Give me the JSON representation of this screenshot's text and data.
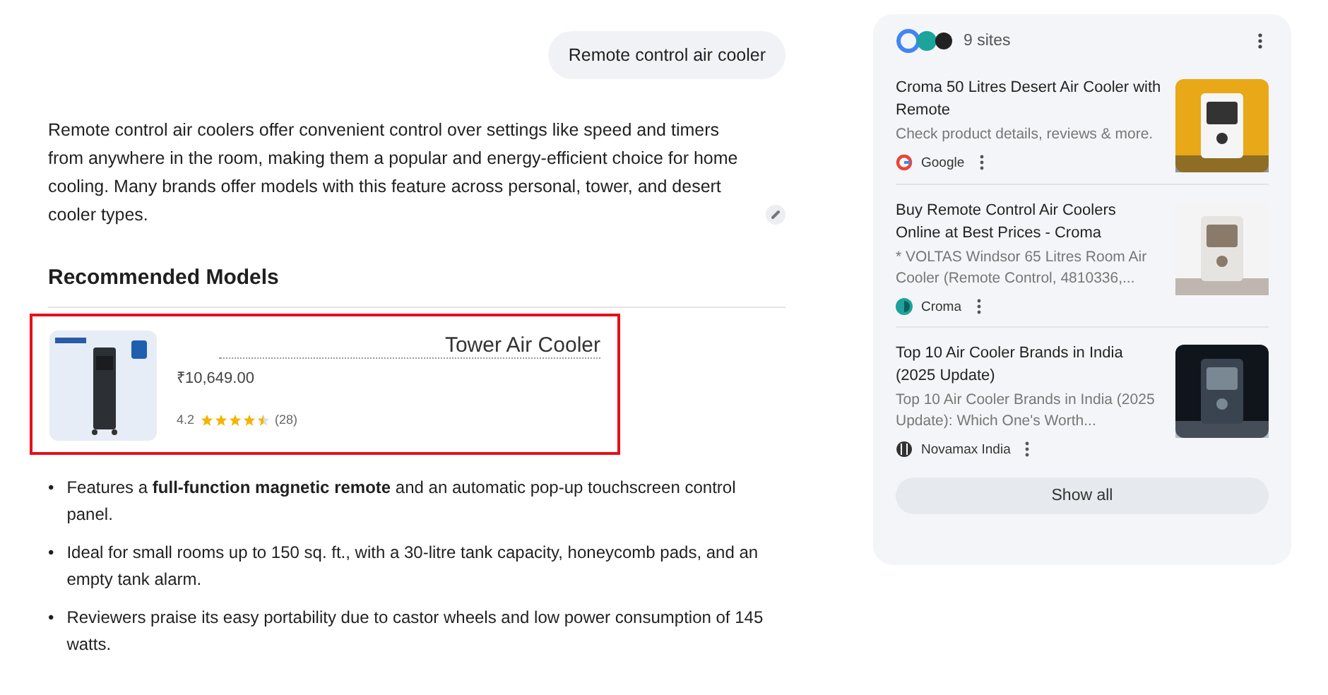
{
  "query": "Remote control air cooler",
  "answer": "Remote control air coolers offer convenient control over settings like speed and timers from anywhere in the room, making them a popular and energy-efficient choice for home cooling. Many brands offer models with this feature across personal, tower, and desert cooler types.",
  "section_title": "Recommended Models",
  "product": {
    "name": "Tower Air Cooler",
    "price": "₹10,649.00",
    "rating": "4.2",
    "stars": 4.5,
    "reviews": "(28)",
    "highlighted": true
  },
  "bullets": [
    {
      "marker": "•",
      "text": "Features a **full-function magnetic remote** and an automatic pop-up touchscreen control panel."
    },
    {
      "marker": "•",
      "text": "Ideal for small rooms up to 150 sq. ft., with a 30-litre tank capacity, honeycomb pads, and an empty tank alarm."
    },
    {
      "marker": "•",
      "text": "Reviewers praise its easy portability due to castor wheels and low power consumption of 145 watts."
    }
  ],
  "sources": {
    "count": "9 sites",
    "items": [
      {
        "title": "Croma 50 Litres Desert Air Cooler with Remote",
        "snippet": "Check product details, reviews & more.",
        "site": "Google"
      },
      {
        "title": "Buy Remote Control Air Coolers Online at Best Prices - Croma",
        "snippet": "* VOLTAS Windsor 65 Litres Room Air Cooler (Remote Control, 4810336,...",
        "site": "Croma"
      },
      {
        "title": "Top 10 Air Cooler Brands in India (2025 Update)",
        "snippet": "Top 10 Air Cooler Brands in India (2025 Update): Which One's Worth...",
        "site": "Novamax India"
      }
    ],
    "show_all": "Show all"
  }
}
